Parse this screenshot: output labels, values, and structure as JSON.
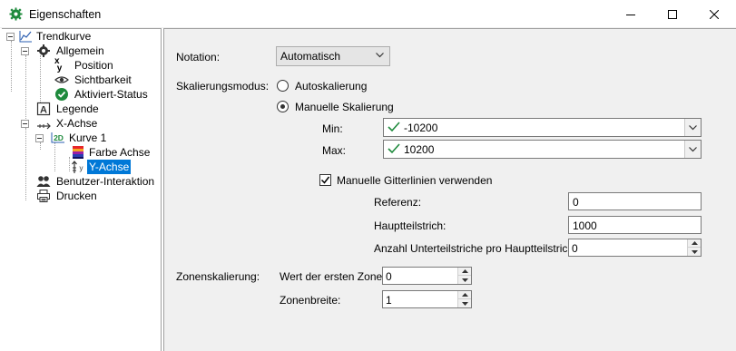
{
  "window": {
    "title": "Eigenschaften",
    "accent": "#1e8a3c"
  },
  "tree": {
    "root": "Trendkurve",
    "allgemein": "Allgemein",
    "position": "Position",
    "sichtbarkeit": "Sichtbarkeit",
    "aktiviert": "Aktiviert-Status",
    "legende": "Legende",
    "xachse": "X-Achse",
    "kurve1": "Kurve 1",
    "farbe_achse": "Farbe Achse",
    "yachse": "Y-Achse",
    "benutzer": "Benutzer-Interaktion",
    "drucken": "Drucken",
    "selected": "Y-Achse",
    "selection_color": "#0078d7"
  },
  "form": {
    "notation_label": "Notation:",
    "notation_value": "Automatisch",
    "skalierung_label": "Skalierungsmodus:",
    "auto_label": "Autoskalierung",
    "manuell_label": "Manuelle Skalierung",
    "min_label": "Min:",
    "min_value": "-10200",
    "max_label": "Max:",
    "max_value": "10200",
    "gitter_label": "Manuelle Gitterlinien verwenden",
    "referenz_label": "Referenz:",
    "referenz_value": "0",
    "haupt_label": "Hauptteilstrich:",
    "haupt_value": "1000",
    "unter_label": "Anzahl Unterteilstriche pro Hauptteilstrich:",
    "unter_value": "0",
    "zonen_label": "Zonenskalierung:",
    "erste_zone_label": "Wert der ersten Zone:",
    "erste_zone_value": "0",
    "zonenbreite_label": "Zonenbreite:",
    "zonenbreite_value": "1"
  }
}
